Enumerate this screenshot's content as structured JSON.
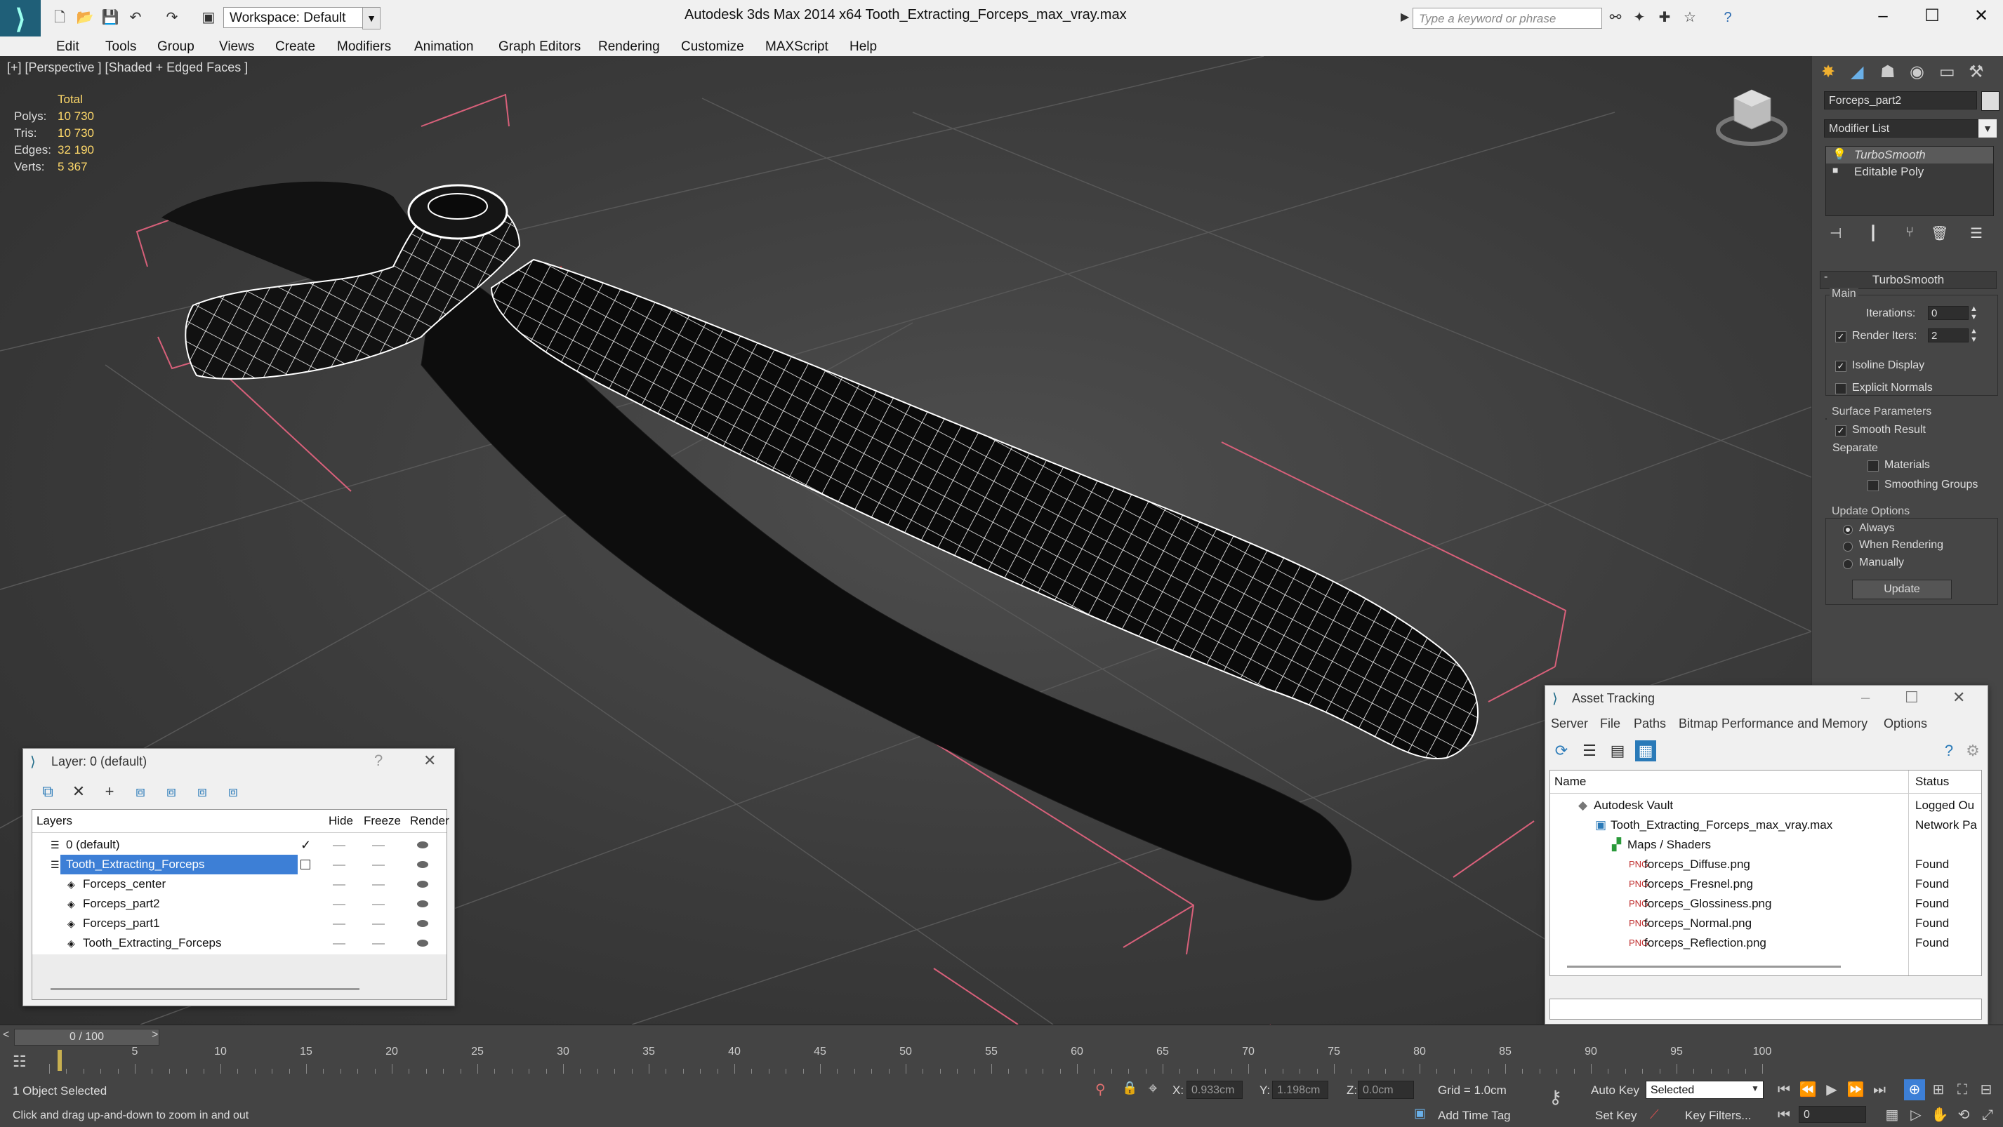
{
  "titlebar": {
    "workspace": "Workspace: Default",
    "app_title": "Autodesk 3ds Max  2014 x64      Tooth_Extracting_Forceps_max_vray.max",
    "search_placeholder": "Type a keyword or phrase"
  },
  "menu": [
    "Edit",
    "Tools",
    "Group",
    "Views",
    "Create",
    "Modifiers",
    "Animation",
    "Graph Editors",
    "Rendering",
    "Customize",
    "MAXScript",
    "Help"
  ],
  "viewport": {
    "label": "[+] [Perspective ] [Shaded + Edged Faces ]",
    "stats_header": "Total",
    "stats": [
      {
        "k": "Polys:",
        "v": "10 730"
      },
      {
        "k": "Tris:",
        "v": "10 730"
      },
      {
        "k": "Edges:",
        "v": "32 190"
      },
      {
        "k": "Verts:",
        "v": "5 367"
      }
    ]
  },
  "command_panel": {
    "object_name": "Forceps_part2",
    "modifier_list": "Modifier List",
    "stack": [
      "TurboSmooth",
      "Editable Poly"
    ],
    "rollout_title": "TurboSmooth",
    "main_label": "Main",
    "iterations_label": "Iterations:",
    "iterations_value": "0",
    "render_iters_label": "Render Iters:",
    "render_iters_value": "2",
    "isoline_display": "Isoline Display",
    "explicit_normals": "Explicit Normals",
    "surface_params": "Surface Parameters",
    "smooth_result": "Smooth Result",
    "separate": "Separate",
    "materials": "Materials",
    "smoothing_groups": "Smoothing Groups",
    "update_options": "Update Options",
    "always": "Always",
    "when_rendering": "When Rendering",
    "manually": "Manually",
    "update_button": "Update"
  },
  "layer_window": {
    "title": "Layer: 0 (default)",
    "help": "?",
    "close": "✕",
    "columns": [
      "Layers",
      "Hide",
      "Freeze",
      "Render"
    ],
    "rows": [
      {
        "name": "0 (default)",
        "indent": 0
      },
      {
        "name": "Tooth_Extracting_Forceps",
        "indent": 0
      },
      {
        "name": "Forceps_center",
        "indent": 1
      },
      {
        "name": "Forceps_part2",
        "indent": 1
      },
      {
        "name": "Forceps_part1",
        "indent": 1
      },
      {
        "name": "Tooth_Extracting_Forceps",
        "indent": 1
      }
    ]
  },
  "asset_window": {
    "title": "Asset Tracking",
    "menu": [
      "Server",
      "File",
      "Paths",
      "Bitmap Performance and Memory",
      "Options"
    ],
    "columns": [
      "Name",
      "Status"
    ],
    "rows": [
      {
        "name": "Autodesk Vault",
        "status": "Logged Ou"
      },
      {
        "name": "Tooth_Extracting_Forceps_max_vray.max",
        "status": "Network Pa"
      },
      {
        "name": "Maps / Shaders",
        "status": ""
      },
      {
        "name": "forceps_Diffuse.png",
        "status": "Found"
      },
      {
        "name": "forceps_Fresnel.png",
        "status": "Found"
      },
      {
        "name": "forceps_Glossiness.png",
        "status": "Found"
      },
      {
        "name": "forceps_Normal.png",
        "status": "Found"
      },
      {
        "name": "forceps_Reflection.png",
        "status": "Found"
      }
    ]
  },
  "timeline": {
    "frame": "0 / 100",
    "ticks": [
      "5",
      "10",
      "15",
      "20",
      "25",
      "30",
      "35",
      "40",
      "45",
      "50",
      "55",
      "60",
      "65",
      "70",
      "75",
      "80",
      "85",
      "90",
      "95",
      "100"
    ]
  },
  "status": {
    "selected": "1 Object Selected",
    "hint": "Click and drag up-and-down to zoom in and out",
    "x_label": "X:",
    "x_value": "0.933cm",
    "y_label": "Y:",
    "y_value": "1.198cm",
    "z_label": "Z:",
    "z_value": "0.0cm",
    "grid": "Grid = 1.0cm",
    "add_time_tag": "Add Time Tag",
    "auto_key": "Auto Key",
    "selected_dropdown": "Selected",
    "set_key": "Set Key",
    "key_filters": "Key Filters...",
    "frame_field": "0"
  }
}
